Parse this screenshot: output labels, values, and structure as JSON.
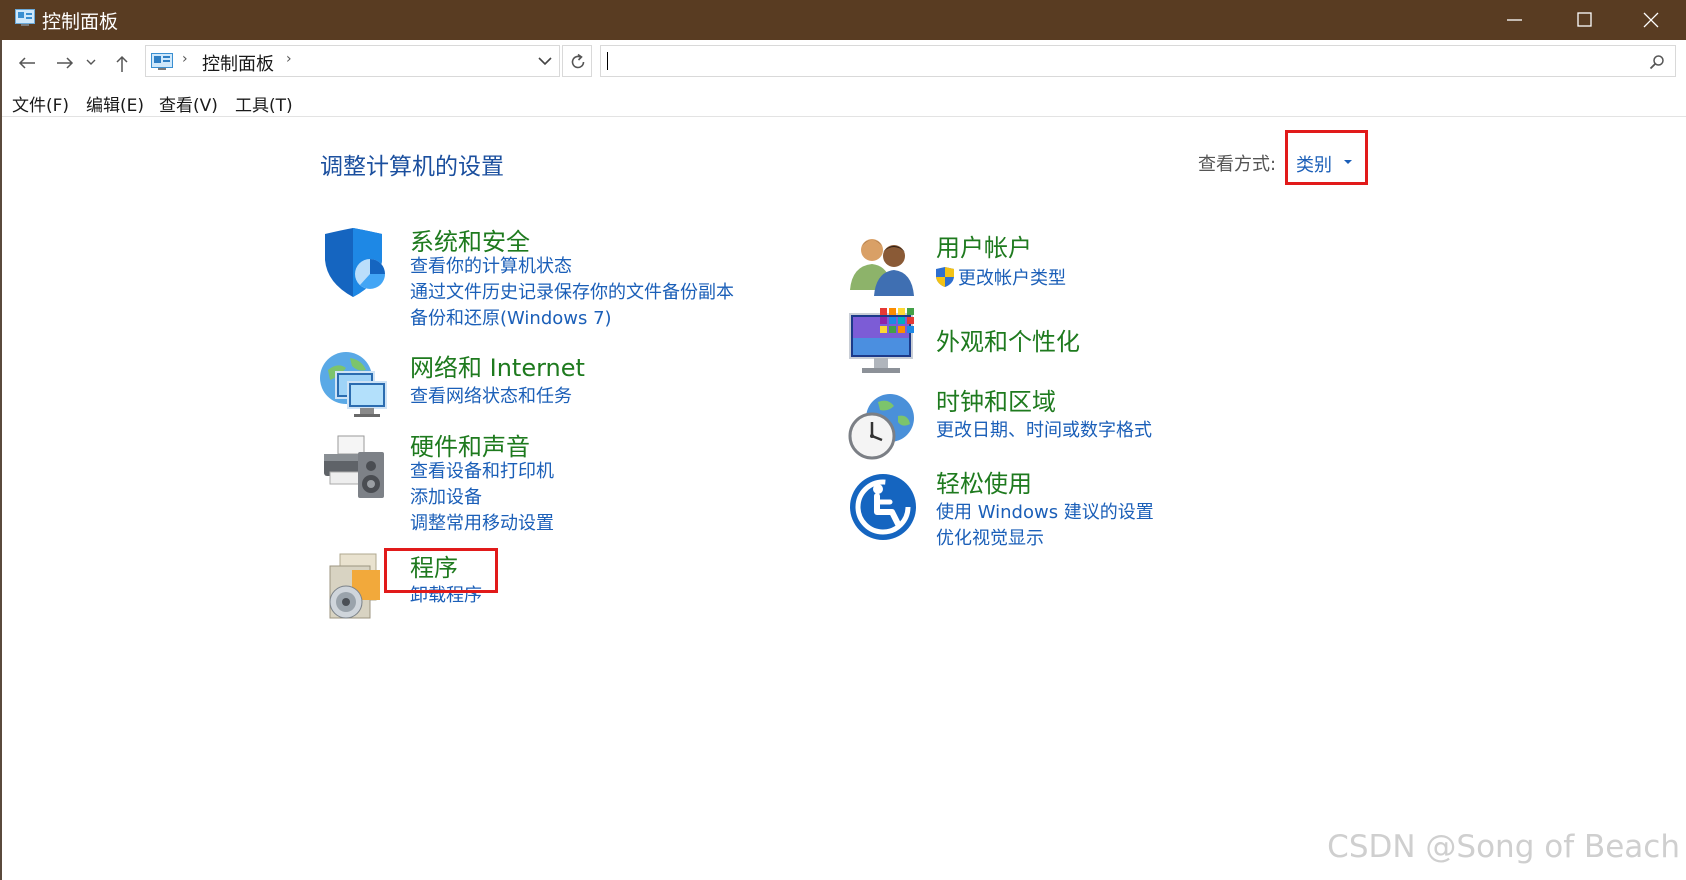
{
  "window": {
    "title": "控制面板"
  },
  "navbar": {
    "breadcrumb": "控制面板",
    "search_placeholder": ""
  },
  "menubar": {
    "items": [
      "文件(F)",
      "编辑(E)",
      "查看(V)",
      "工具(T)"
    ]
  },
  "main": {
    "title": "调整计算机的设置",
    "view_by": {
      "label": "查看方式:",
      "value": "类别"
    },
    "categories": [
      {
        "name": "系统和安全",
        "icon": "shield-icon",
        "links": [
          "查看你的计算机状态",
          "通过文件历史记录保存你的文件备份副本",
          "备份和还原(Windows 7)"
        ]
      },
      {
        "name": "网络和 Internet",
        "icon": "network-globe-icon",
        "links": [
          "查看网络状态和任务"
        ]
      },
      {
        "name": "硬件和声音",
        "icon": "printer-speaker-icon",
        "links": [
          "查看设备和打印机",
          "添加设备",
          "调整常用移动设置"
        ]
      },
      {
        "name": "程序",
        "icon": "programs-disc-icon",
        "links": [
          "卸载程序"
        ]
      },
      {
        "name": "用户帐户",
        "icon": "users-icon",
        "links": [
          "更改帐户类型"
        ]
      },
      {
        "name": "外观和个性化",
        "icon": "monitor-colors-icon",
        "links": []
      },
      {
        "name": "时钟和区域",
        "icon": "clock-globe-icon",
        "links": [
          "更改日期、时间或数字格式"
        ]
      },
      {
        "name": "轻松使用",
        "icon": "ease-of-access-icon",
        "links": [
          "使用 Windows 建议的设置",
          "优化视觉显示"
        ]
      }
    ]
  },
  "watermark": "CSDN @Song of Beach",
  "colors": {
    "titlebar": "#593c22",
    "heading_green": "#1e7a1e",
    "link_blue": "#1b5fb8",
    "title_blue": "#1b4f9e",
    "highlight_red": "#e11a1a"
  }
}
